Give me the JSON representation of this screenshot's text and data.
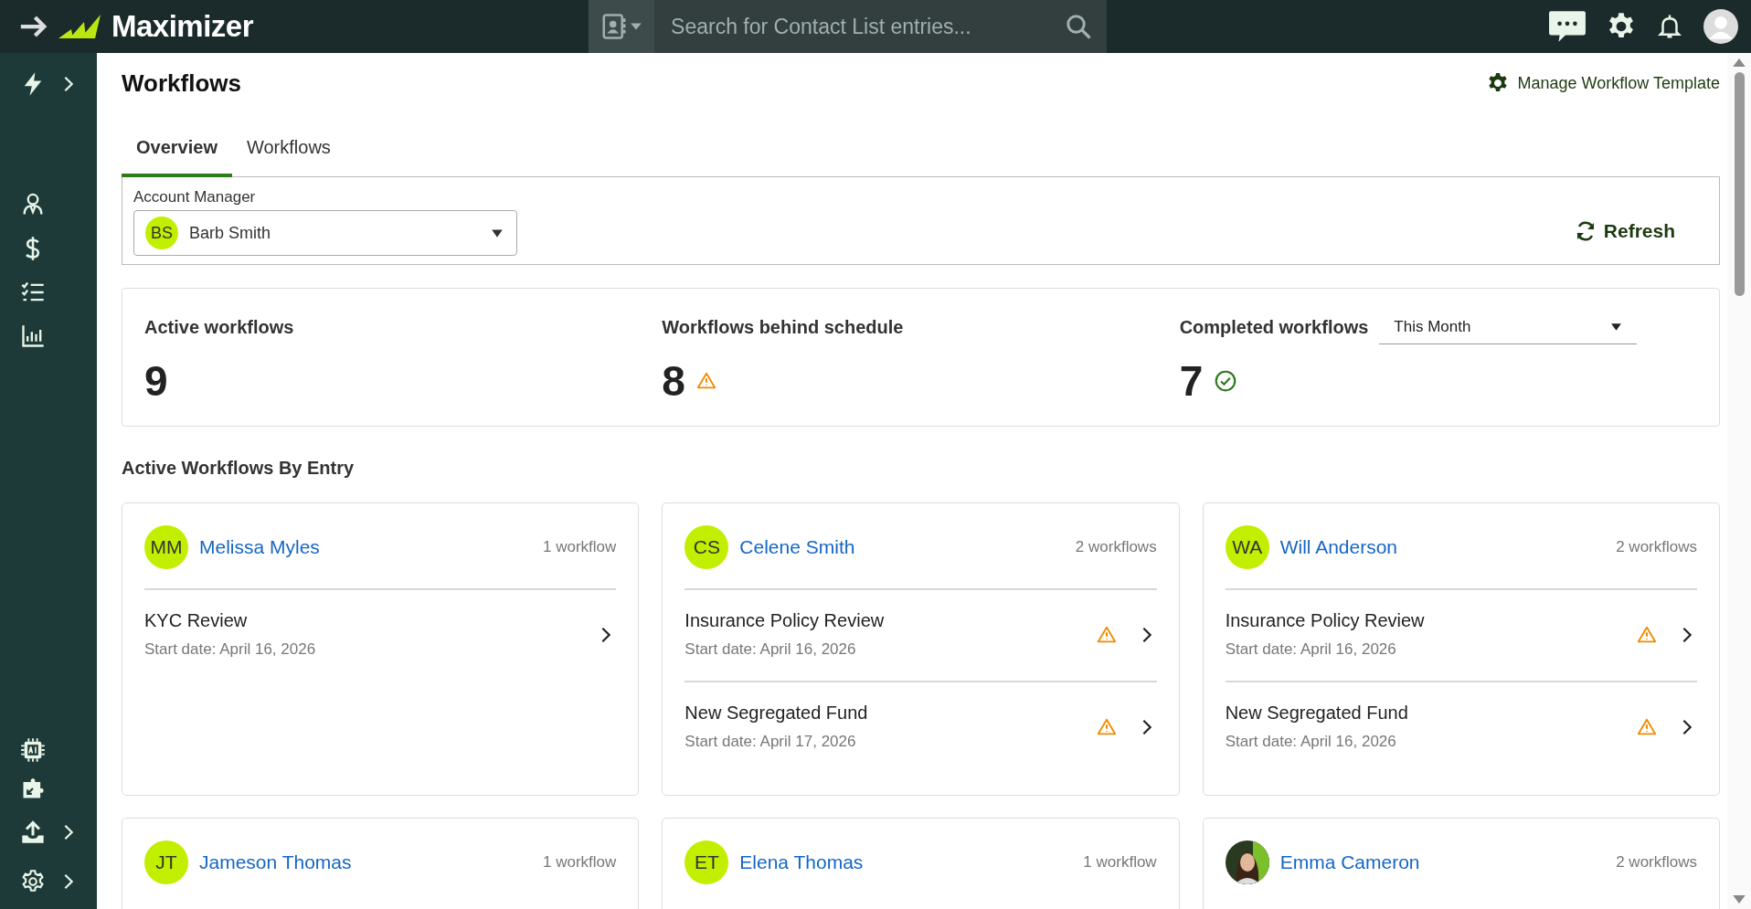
{
  "topbar": {
    "brand": "Maximizer",
    "search": {
      "placeholder": "Search for Contact List entries..."
    }
  },
  "page": {
    "title": "Workflows",
    "action": "Manage Workflow Template"
  },
  "tabs": [
    {
      "label": "Overview",
      "selected": true
    },
    {
      "label": "Workflows",
      "selected": false
    }
  ],
  "filter": {
    "label": "Account Manager",
    "initials": "BS",
    "value": "Barb Smith",
    "refresh": "Refresh"
  },
  "stats": [
    {
      "label": "Active workflows",
      "value": "9",
      "kind": "plain"
    },
    {
      "label": "Workflows behind schedule",
      "value": "8",
      "kind": "warning"
    },
    {
      "label": "Completed workflows",
      "value": "7",
      "kind": "done",
      "period": "This Month"
    }
  ],
  "section_title": "Active Workflows By Entry",
  "entries": [
    {
      "name": "Melissa Myles",
      "kind": "initials",
      "initials": "MM",
      "count": "1 workflow",
      "workflows": [
        {
          "title": "KYC Review",
          "start": "Start date: April 16, 2026",
          "behind": false
        }
      ]
    },
    {
      "name": "Celene Smith",
      "kind": "initials",
      "initials": "CS",
      "count": "2 workflows",
      "workflows": [
        {
          "title": "Insurance Policy Review",
          "start": "Start date: April 16, 2026",
          "behind": true
        },
        {
          "title": "New Segregated Fund",
          "start": "Start date: April 17, 2026",
          "behind": true
        }
      ]
    },
    {
      "name": "Will Anderson",
      "kind": "initials",
      "initials": "WA",
      "count": "2 workflows",
      "workflows": [
        {
          "title": "Insurance Policy Review",
          "start": "Start date: April 16, 2026",
          "behind": true
        },
        {
          "title": "New Segregated Fund",
          "start": "Start date: April 16, 2026",
          "behind": true
        }
      ]
    },
    {
      "name": "Jameson Thomas",
      "kind": "initials",
      "initials": "JT",
      "count": "1 workflow"
    },
    {
      "name": "Elena Thomas",
      "kind": "initials",
      "initials": "ET",
      "count": "1 workflow"
    },
    {
      "name": "Emma Cameron",
      "kind": "picture",
      "count": "2 workflows"
    }
  ]
}
